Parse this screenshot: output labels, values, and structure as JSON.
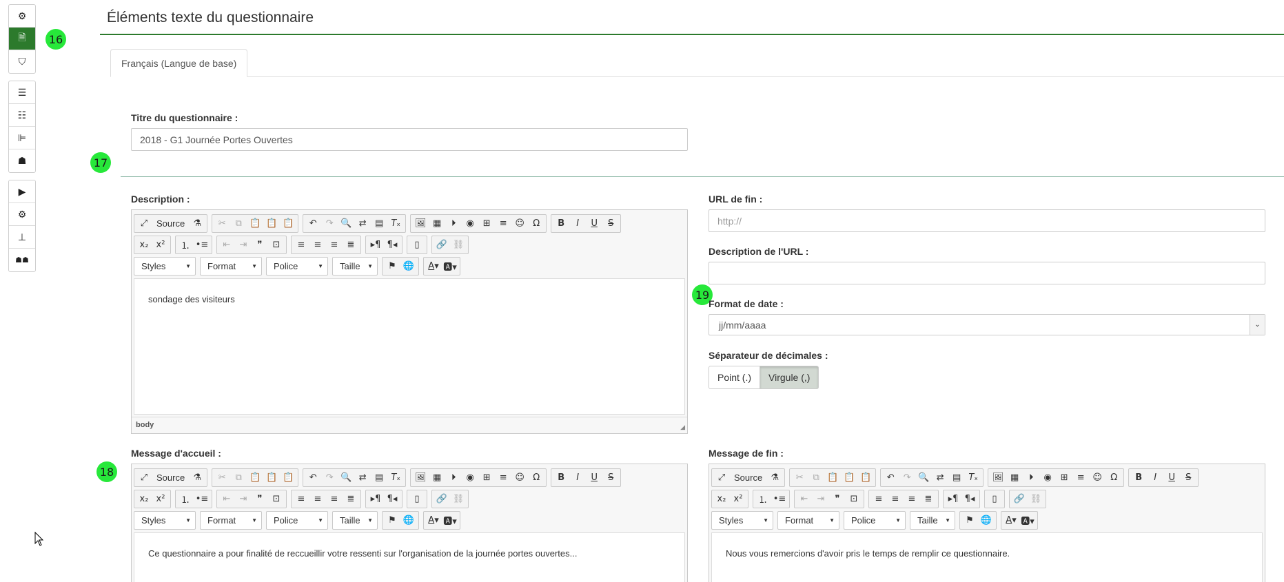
{
  "sidebar": {
    "groups": [
      [
        {
          "icon": "cogs-icon",
          "glyph": "⚙"
        },
        {
          "icon": "file-text-icon",
          "glyph": "🗎",
          "active": true
        },
        {
          "icon": "shield-icon",
          "glyph": "⛉"
        }
      ],
      [
        {
          "icon": "list-icon",
          "glyph": "☰"
        },
        {
          "icon": "list-alt-icon",
          "glyph": "☷"
        },
        {
          "icon": "structure-icon",
          "glyph": "⊫"
        },
        {
          "icon": "user-icon",
          "glyph": "☗"
        }
      ],
      [
        {
          "icon": "play-icon",
          "glyph": "▶"
        },
        {
          "icon": "gear-icon",
          "glyph": "⚙"
        },
        {
          "icon": "sitemap-icon",
          "glyph": "⊥"
        },
        {
          "icon": "users-icon",
          "glyph": "☗☗"
        }
      ]
    ]
  },
  "badges": {
    "b16": "16",
    "b17": "17",
    "b18": "18",
    "b19": "19"
  },
  "page": {
    "title": "Éléments texte du questionnaire"
  },
  "tabs": {
    "active": "Français (Langue de base)"
  },
  "survey": {
    "title_label": "Titre du questionnaire :",
    "title_value": "2018 - G1 Journée Portes Ouvertes"
  },
  "description": {
    "label": "Description :",
    "content": "sondage des visiteurs",
    "status": "body"
  },
  "welcome": {
    "label": "Message d'accueil :",
    "content": "Ce questionnaire a pour finalité de reccueillir votre ressenti sur l'organisation de la journée portes ouvertes..."
  },
  "end": {
    "label": "Message de fin :",
    "content": "Nous vous remercions d'avoir pris le temps de remplir ce questionnaire."
  },
  "end_url": {
    "label": "URL de fin :",
    "placeholder": "http://"
  },
  "url_description": {
    "label": "Description de l'URL :"
  },
  "date_format": {
    "label": "Format de date :",
    "value": "jj/mm/aaaa"
  },
  "decimal": {
    "label": "Séparateur de décimales :",
    "options": [
      "Point (.)",
      "Virgule (,)"
    ],
    "selected": "Virgule (,)"
  },
  "editor_toolbar": {
    "source": "Source",
    "styles": "Styles",
    "format": "Format",
    "police": "Police",
    "taille": "Taille"
  }
}
